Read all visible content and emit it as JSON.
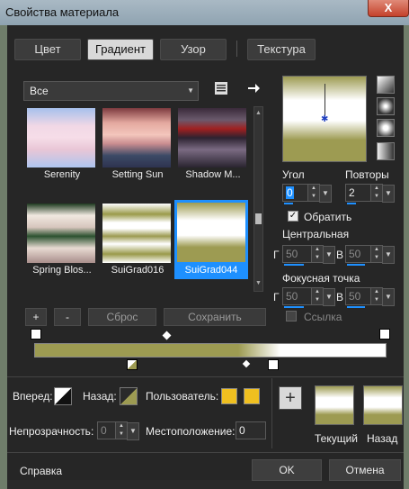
{
  "window": {
    "title": "Свойства материала",
    "close_glyph": "X"
  },
  "tabs": [
    {
      "label": "Цвет"
    },
    {
      "label": "Градиент"
    },
    {
      "label": "Узор"
    },
    {
      "label": "Текстура"
    }
  ],
  "category_dropdown": {
    "value": "Все"
  },
  "gradients": [
    {
      "name": "Serenity"
    },
    {
      "name": "Setting Sun"
    },
    {
      "name": "Shadow M..."
    },
    {
      "name": "Spring Blos..."
    },
    {
      "name": "SuiGrad016"
    },
    {
      "name": "SuiGrad044"
    }
  ],
  "list_buttons": {
    "add": "+",
    "remove": "-",
    "reset": "Сброс",
    "save": "Сохранить"
  },
  "settings": {
    "angle_label": "Угол",
    "angle_value": "0",
    "repeats_label": "Повторы",
    "repeats_value": "2",
    "invert_label": "Обратить",
    "center_label": "Центральная",
    "center_h_label": "Г",
    "center_h_value": "50",
    "center_v_label": "В",
    "center_v_value": "50",
    "focal_label": "Фокусная точка",
    "focal_h_label": "Г",
    "focal_h_value": "50",
    "focal_v_label": "В",
    "focal_v_value": "50",
    "link_label": "Ссылка"
  },
  "bottom": {
    "forward_label": "Вперед:",
    "back_label": "Назад:",
    "user_label": "Пользователь:",
    "opacity_label": "Непрозрачность:",
    "opacity_value": "0",
    "location_label": "Местоположение:",
    "location_value": "0",
    "current_label": "Текущий",
    "previous_label": "Назад",
    "add_glyph": "+"
  },
  "footer": {
    "help": "Справка",
    "ok": "OK",
    "cancel": "Отмена"
  },
  "colors": {
    "olive": "#9d9b52",
    "highlight": "#1e90ff",
    "user_swatch": "#f0c020"
  }
}
